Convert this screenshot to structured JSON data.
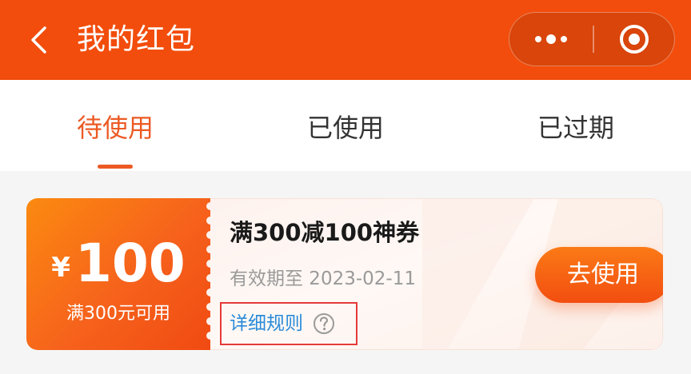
{
  "header": {
    "title": "我的红包",
    "back_icon": "chevron-left-icon",
    "more_icon": "more-dots-icon",
    "close_icon": "target-circle-icon",
    "background_color": "#f24d0c"
  },
  "tabs": [
    {
      "label": "待使用",
      "active": true
    },
    {
      "label": "已使用",
      "active": false
    },
    {
      "label": "已过期",
      "active": false
    }
  ],
  "coupon": {
    "currency": "¥",
    "amount": "100",
    "condition": "满300元可用",
    "name": "满300减100神券",
    "validity": "有效期至 2023-02-11",
    "rules_label": "详细规则",
    "help_icon": "question-circle-icon",
    "use_label": "去使用"
  },
  "colors": {
    "accent": "#ec5a24",
    "link": "#2a8bd8",
    "highlight_border": "#e53a3a"
  }
}
